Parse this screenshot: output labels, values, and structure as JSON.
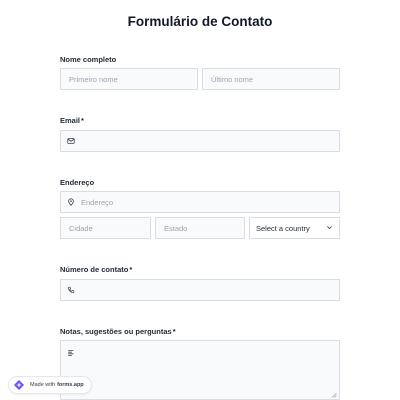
{
  "form": {
    "title": "Formulário de Contato",
    "required_mark": "*",
    "name": {
      "label": "Nome completo",
      "first_placeholder": "Primeiro nome",
      "last_placeholder": "Último nome"
    },
    "email": {
      "label": "Email",
      "placeholder": "",
      "icon": "envelope-icon"
    },
    "address": {
      "label": "Endereço",
      "street_placeholder": "Endereço",
      "street_icon": "map-pin-icon",
      "city_placeholder": "Cidade",
      "state_placeholder": "Estado",
      "country_selected": "Select a country"
    },
    "phone": {
      "label": "Número de contato",
      "placeholder": "",
      "icon": "phone-icon"
    },
    "notes": {
      "label": "Notas, sugestões ou perguntas",
      "placeholder": "",
      "icon": "text-align-icon"
    }
  },
  "footer_badge": {
    "prefix": "Made with",
    "brand": "forms.app"
  },
  "colors": {
    "input_bg": "#f9fafb",
    "input_border": "#d9dde3",
    "placeholder": "#9ca3af",
    "text": "#1f2937",
    "badge_logo": "#6d4aff"
  }
}
